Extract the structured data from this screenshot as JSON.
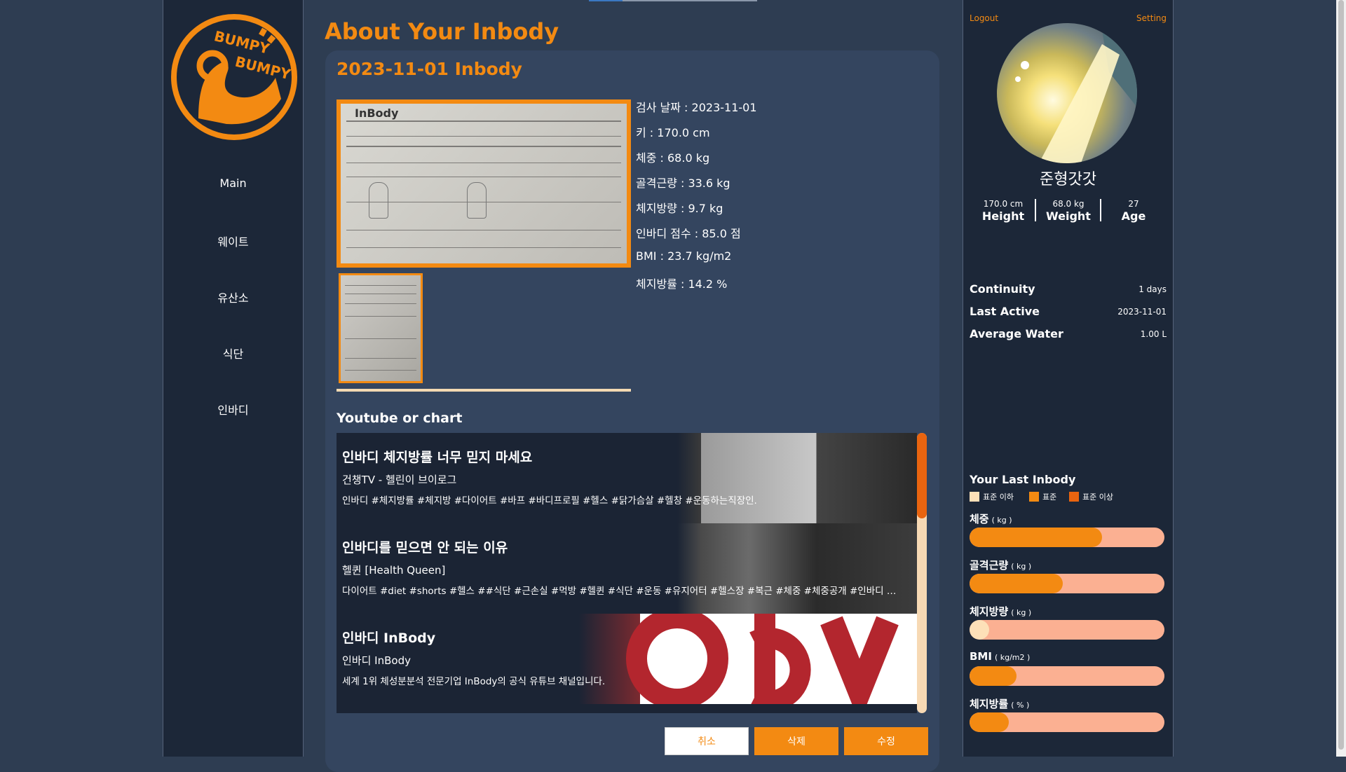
{
  "brand": {
    "logo_text_1": "BUMPY",
    "logo_text_2": "BUMPY"
  },
  "nav": {
    "items": [
      {
        "label": "Main"
      },
      {
        "label": "웨이트"
      },
      {
        "label": "유산소"
      },
      {
        "label": "식단"
      },
      {
        "label": "인바디"
      }
    ]
  },
  "page": {
    "title": "About Your Inbody"
  },
  "inbody": {
    "card_title": "2023-11-01 Inbody",
    "photo_brand": "InBody",
    "info": [
      "검사 날짜 : 2023-11-01",
      "키 : 170.0 cm",
      "체중 : 68.0 kg",
      "골격근량 : 33.6 kg",
      "체지방량 : 9.7 kg",
      "인바디 점수 : 85.0 점",
      "BMI : 23.7 kg/m2",
      "체지방률 : 14.2 %"
    ]
  },
  "videos": {
    "section_title": "Youtube or chart",
    "items": [
      {
        "title": "인바디 체지방률 너무 믿지 마세요",
        "channel": "건챙TV - 헬린이 브이로그",
        "description": "인바디 #체지방률 #체지방 #다이어트 #바프 #바디프로필 #헬스 #닭가슴살 #헬창 #운동하는직장인."
      },
      {
        "title": "인바디를 믿으면 안 되는 이유",
        "channel": "헬퀸 [Health Queen]",
        "description": "다이어트 #diet #shorts #헬스 ##식단 #근손실 #먹방 #헬퀸 #식단 #운동 #유지어터 #헬스장 #복근 #체중 #체중공개 #인바디 #눈바…"
      },
      {
        "title": "인바디 InBody",
        "channel": "인바디 InBody",
        "description": "세계 1위 체성분분석 전문기업 InBody의 공식 유튜브 채널입니다."
      }
    ]
  },
  "actions": {
    "cancel": "취소",
    "delete": "삭제",
    "edit": "수정"
  },
  "profile": {
    "logout": "Logout",
    "setting": "Setting",
    "username": "준형갓갓",
    "height_val": "170.0 cm",
    "height_lbl": "Height",
    "weight_val": "68.0 kg",
    "weight_lbl": "Weight",
    "age_val": "27",
    "age_lbl": "Age",
    "continuity_lbl": "Continuity",
    "continuity_val": "1 days",
    "last_active_lbl": "Last Active",
    "last_active_val": "2023-11-01",
    "avg_water_lbl": "Average Water",
    "avg_water_val": "1.00 L"
  },
  "last_inbody": {
    "title": "Your Last Inbody",
    "legend": [
      {
        "label": "표준 이하",
        "color": "#fde0b8"
      },
      {
        "label": "표준",
        "color": "#f38a12"
      },
      {
        "label": "표준 이상",
        "color": "#e9640f"
      }
    ],
    "bars": [
      {
        "label": "체중",
        "unit": "( kg )",
        "fill_fraction": 0.68,
        "color": "#f38a12"
      },
      {
        "label": "골격근량",
        "unit": "( kg )",
        "fill_fraction": 0.48,
        "color": "#f38a12"
      },
      {
        "label": "체지방량",
        "unit": "( kg )",
        "fill_fraction": 0.1,
        "color": "#fde0b8"
      },
      {
        "label": "BMI",
        "unit": "( kg/m2 )",
        "fill_fraction": 0.24,
        "color": "#f38a12"
      },
      {
        "label": "체지방률",
        "unit": "( % )",
        "fill_fraction": 0.2,
        "color": "#f38a12"
      }
    ]
  },
  "colors": {
    "accent": "#f38a12",
    "panel": "#1c2738",
    "background": "#2e3d52",
    "card": "#34455f"
  }
}
